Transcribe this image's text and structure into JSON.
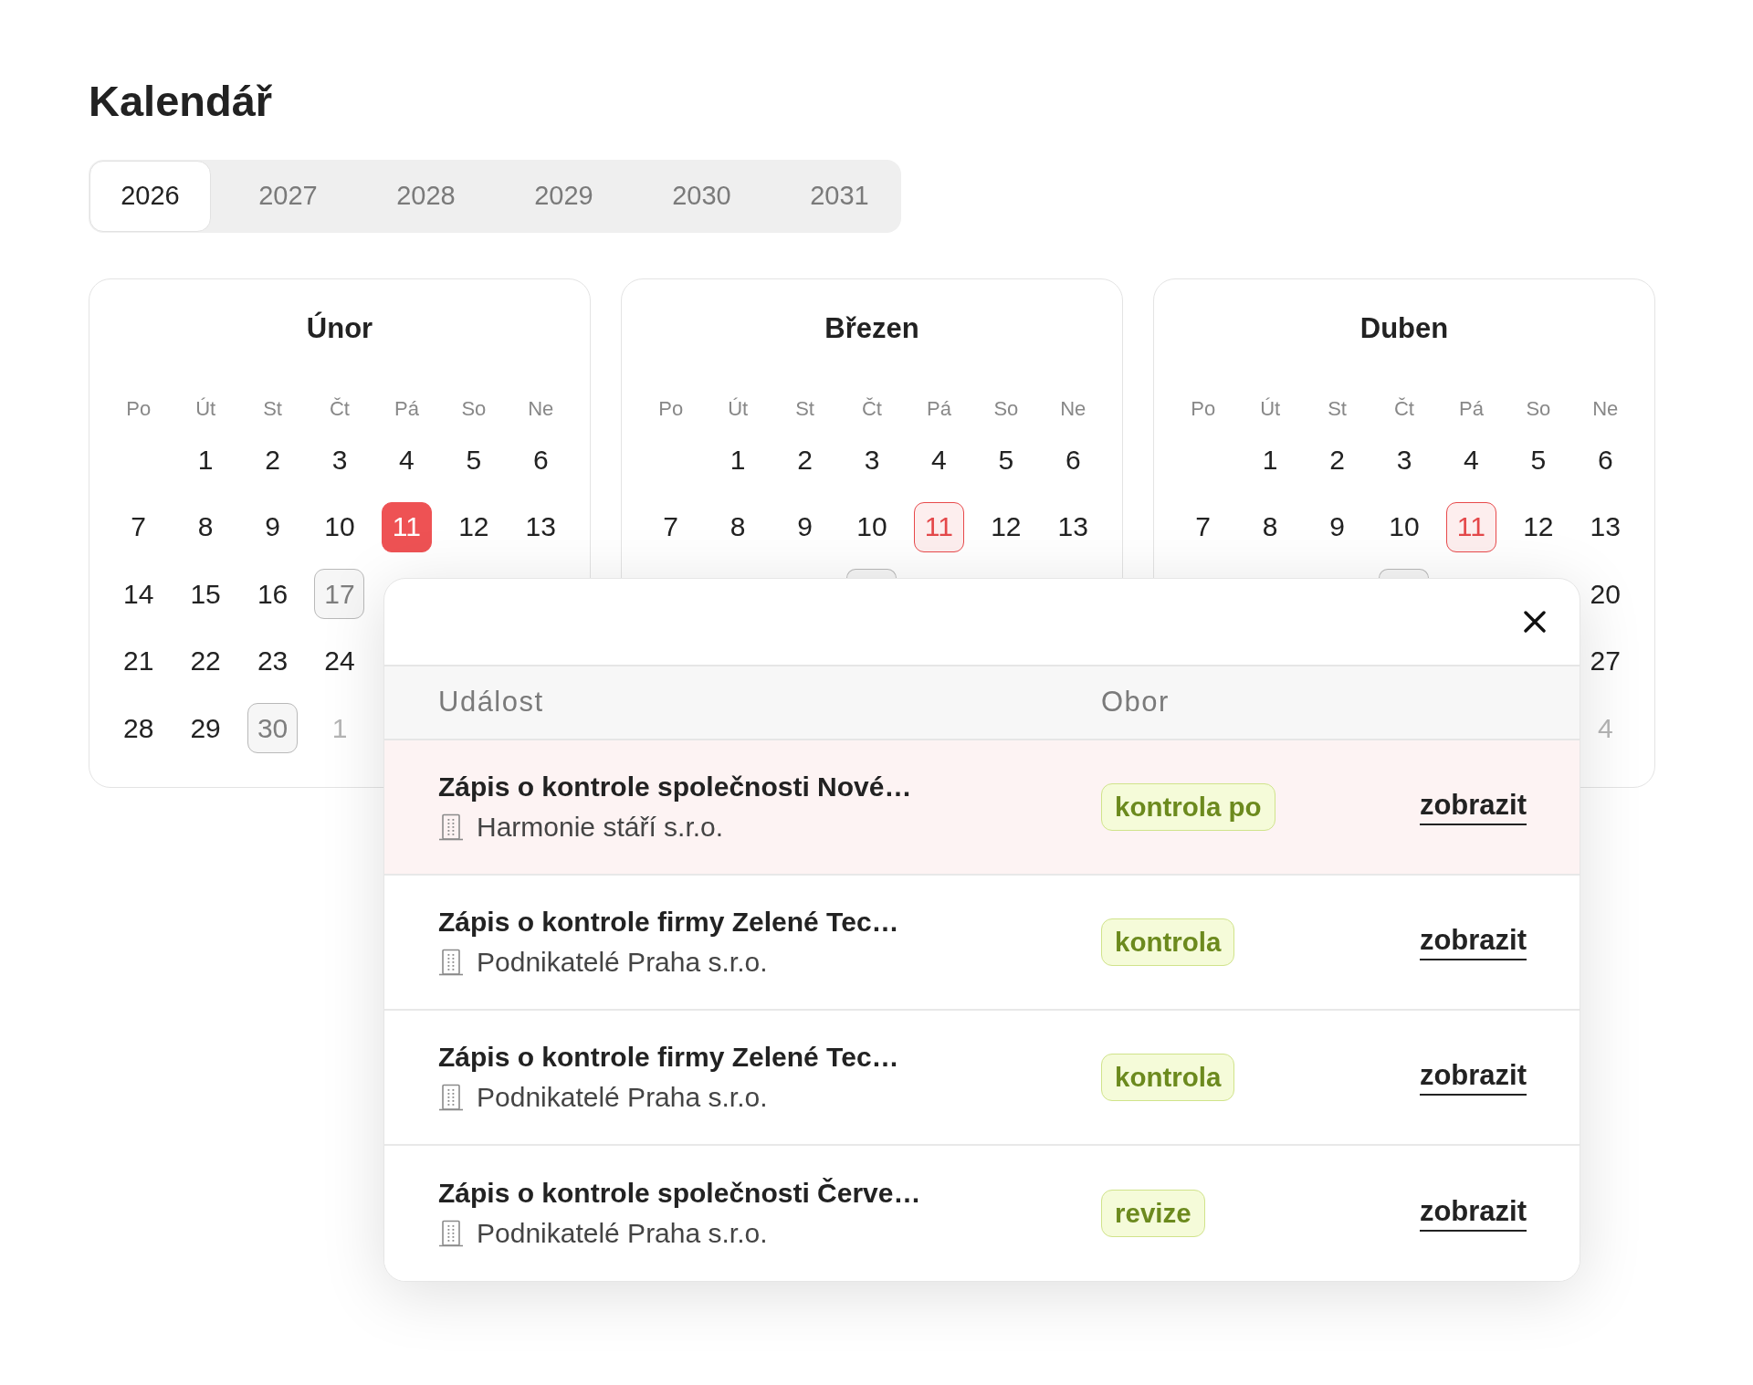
{
  "page": {
    "title": "Kalendář"
  },
  "year_tabs": [
    {
      "label": "2026",
      "selected": true
    },
    {
      "label": "2027",
      "selected": false
    },
    {
      "label": "2028",
      "selected": false
    },
    {
      "label": "2029",
      "selected": false
    },
    {
      "label": "2030",
      "selected": false
    },
    {
      "label": "2031",
      "selected": false
    }
  ],
  "months": [
    {
      "name": "Únor",
      "weekdays": [
        "Po",
        "Út",
        "St",
        "Čt",
        "Pá",
        "So",
        "Ne"
      ],
      "weeks": [
        {
          "tue": {
            "kind": "plain",
            "text": "1"
          },
          "wed": {
            "kind": "plain",
            "text": "2"
          },
          "thu": {
            "kind": "plain",
            "text": "3"
          },
          "fri": {
            "kind": "plain",
            "text": "4"
          },
          "sat": {
            "kind": "plain",
            "text": "5"
          },
          "sun": {
            "kind": "plain",
            "text": "6"
          }
        },
        {
          "mon": {
            "kind": "plain",
            "text": "7"
          },
          "tue": {
            "kind": "plain",
            "text": "8"
          },
          "wed": {
            "kind": "plain",
            "text": "9"
          },
          "thu": {
            "kind": "plain",
            "text": "10"
          },
          "fri": {
            "kind": "selected",
            "text": "11"
          },
          "sat": {
            "kind": "plain",
            "text": "12"
          },
          "sun": {
            "kind": "plain",
            "text": "13"
          }
        },
        {
          "mon": {
            "kind": "plain",
            "text": "14"
          },
          "tue": {
            "kind": "plain",
            "text": "15"
          },
          "wed": {
            "kind": "plain",
            "text": "16"
          },
          "thu": {
            "kind": "marked",
            "text": "17"
          }
        },
        {
          "mon": {
            "kind": "plain",
            "text": "21"
          },
          "tue": {
            "kind": "plain",
            "text": "22"
          },
          "wed": {
            "kind": "plain",
            "text": "23"
          },
          "thu": {
            "kind": "plain",
            "text": "24"
          }
        },
        {
          "mon": {
            "kind": "plain",
            "text": "28"
          },
          "tue": {
            "kind": "plain",
            "text": "29"
          },
          "wed": {
            "kind": "marked",
            "text": "30"
          },
          "thu": {
            "kind": "outside",
            "text": "1"
          }
        }
      ]
    },
    {
      "name": "Březen",
      "weekdays": [
        "Po",
        "Út",
        "St",
        "Čt",
        "Pá",
        "So",
        "Ne"
      ],
      "weeks": [
        {
          "tue": {
            "kind": "plain",
            "text": "1"
          },
          "wed": {
            "kind": "plain",
            "text": "2"
          },
          "thu": {
            "kind": "plain",
            "text": "3"
          },
          "fri": {
            "kind": "plain",
            "text": "4"
          },
          "sat": {
            "kind": "plain",
            "text": "5"
          },
          "sun": {
            "kind": "plain",
            "text": "6"
          }
        },
        {
          "mon": {
            "kind": "plain",
            "text": "7"
          },
          "tue": {
            "kind": "plain",
            "text": "8"
          },
          "wed": {
            "kind": "plain",
            "text": "9"
          },
          "thu": {
            "kind": "plain",
            "text": "10"
          },
          "fri": {
            "kind": "ring",
            "text": "11"
          },
          "sat": {
            "kind": "plain",
            "text": "12"
          },
          "sun": {
            "kind": "plain",
            "text": "13"
          }
        },
        {
          "thu": {
            "kind": "edge"
          }
        }
      ]
    },
    {
      "name": "Duben",
      "weekdays": [
        "Po",
        "Út",
        "St",
        "Čt",
        "Pá",
        "So",
        "Ne"
      ],
      "weeks": [
        {
          "tue": {
            "kind": "plain",
            "text": "1"
          },
          "wed": {
            "kind": "plain",
            "text": "2"
          },
          "thu": {
            "kind": "plain",
            "text": "3"
          },
          "fri": {
            "kind": "plain",
            "text": "4"
          },
          "sat": {
            "kind": "plain",
            "text": "5"
          },
          "sun": {
            "kind": "plain",
            "text": "6"
          }
        },
        {
          "mon": {
            "kind": "plain",
            "text": "7"
          },
          "tue": {
            "kind": "plain",
            "text": "8"
          },
          "wed": {
            "kind": "plain",
            "text": "9"
          },
          "thu": {
            "kind": "plain",
            "text": "10"
          },
          "fri": {
            "kind": "ring",
            "text": "11"
          },
          "sat": {
            "kind": "plain",
            "text": "12"
          },
          "sun": {
            "kind": "plain",
            "text": "13"
          }
        },
        {
          "thu": {
            "kind": "edge"
          },
          "sun": {
            "kind": "plain",
            "text": "20"
          }
        },
        {
          "sun": {
            "kind": "plain",
            "text": "27"
          }
        },
        {
          "sun": {
            "kind": "outside",
            "text": "4"
          }
        }
      ]
    }
  ],
  "events_popup": {
    "columns": [
      "Událost",
      "Obor"
    ],
    "rows": [
      {
        "title": "Zápis o kontrole společnosti Nové…",
        "organization": "Harmonie stáří s.r.o.",
        "field": "kontrola po",
        "action": "zobrazit",
        "selected": true
      },
      {
        "title": "Zápis o kontrole firmy Zelené Tec…",
        "organization": "Podnikatelé Praha s.r.o.",
        "field": "kontrola",
        "action": "zobrazit",
        "selected": false
      },
      {
        "title": "Zápis o kontrole firmy Zelené Tec…",
        "organization": "Podnikatelé Praha s.r.o.",
        "field": "kontrola",
        "action": "zobrazit",
        "selected": false
      },
      {
        "title": "Zápis o kontrole společnosti Červe…",
        "organization": "Podnikatelé Praha s.r.o.",
        "field": "revize",
        "action": "zobrazit",
        "selected": false
      }
    ]
  }
}
